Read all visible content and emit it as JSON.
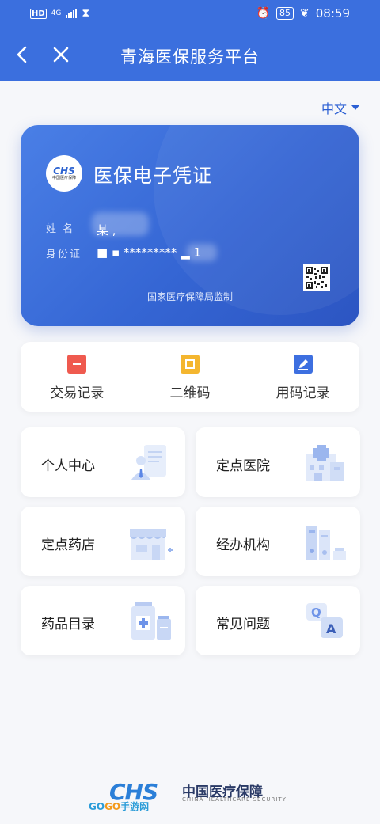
{
  "status_bar": {
    "network": "4G",
    "battery": "85",
    "time": "08:59"
  },
  "header": {
    "title": "青海医保服务平台"
  },
  "language": {
    "selected": "中文"
  },
  "card": {
    "logo_text": "CHS",
    "logo_sub": "中国医疗保障",
    "title": "医保电子凭证",
    "name_label": "姓 名",
    "name_value": "某 ,",
    "id_label": "身份证",
    "id_value": "■ ▪ ********* ▂ 1",
    "supervision": "国家医疗保障局监制"
  },
  "quick_actions": [
    {
      "label": "交易记录",
      "icon": "document-icon",
      "color": "#ef5a4f"
    },
    {
      "label": "二维码",
      "icon": "qrcode-icon",
      "color": "#f4b62f"
    },
    {
      "label": "用码记录",
      "icon": "edit-icon",
      "color": "#3d6fe0"
    }
  ],
  "tiles": [
    {
      "label": "个人中心",
      "icon": "user-profile-icon"
    },
    {
      "label": "定点医院",
      "icon": "hospital-icon"
    },
    {
      "label": "定点药店",
      "icon": "pharmacy-icon"
    },
    {
      "label": "经办机构",
      "icon": "office-files-icon"
    },
    {
      "label": "药品目录",
      "icon": "medicine-icon"
    },
    {
      "label": "常见问题",
      "icon": "qa-icon"
    }
  ],
  "footer": {
    "logo_text": "CHS",
    "brand_cn": "中国医疗保障",
    "brand_en": "CHINA HEALTHCARE SECURITY",
    "watermark_prefix": "GO",
    "watermark_mid": "GO",
    "watermark_suffix": "手游网"
  },
  "colors": {
    "primary": "#3b6fde",
    "card_start": "#4a7fe6",
    "card_end": "#2c55c2",
    "accent_text": "#2b5fd3"
  }
}
